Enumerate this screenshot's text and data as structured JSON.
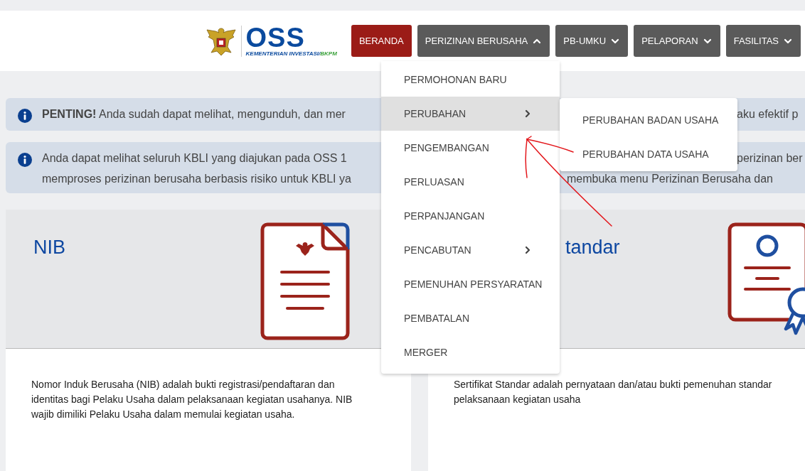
{
  "header": {
    "logo": {
      "name": "OSS",
      "subtitle": "KEMENTERIAN INVESTASI/",
      "subtitle_accent": "BKPM"
    },
    "nav": [
      {
        "label": "BERANDA",
        "kind": "link",
        "selected": true
      },
      {
        "label": "PERIZINAN BERUSAHA",
        "kind": "dropdown",
        "selected": false,
        "expanded": true
      },
      {
        "label": "PB-UMKU",
        "kind": "dropdown",
        "selected": false,
        "expanded": false
      },
      {
        "label": "PELAPORAN",
        "kind": "dropdown",
        "selected": false,
        "expanded": false
      },
      {
        "label": "FASILITAS",
        "kind": "dropdown",
        "selected": false,
        "expanded": false
      }
    ]
  },
  "alerts": [
    {
      "lines": [
        {
          "left": "**PENTING!** Anda sudah dapat melihat, mengunduh, dan mer",
          "right": "aku efektif p"
        }
      ]
    },
    {
      "lines": [
        {
          "left": "Anda dapat melihat seluruh KBLI yang diajukan pada OSS 1",
          "right": "perizinan ber"
        },
        {
          "left": "memproses perizinan berusaha berbasis risiko untuk KBLI ya",
          "right": "membuka menu Perizinan Berusaha dan"
        }
      ]
    }
  ],
  "cards": [
    {
      "title": "NIB",
      "kind": "document",
      "description": "Nomor Induk Berusaha (NIB) adalah bukti registrasi/pendaftaran dan identitas bagi Pelaku Usaha dalam pelaksanaan kegiatan usahanya. NIB wajib dimiliki Pelaku Usaha dalam memulai kegiatan usaha."
    },
    {
      "title": "tandar",
      "kind": "certificate",
      "description": "Sertifikat Standar adalah pernyataan dan/atau bukti pemenuhan standar pelaksanaan kegiatan usaha"
    }
  ],
  "dropdown_menu": {
    "items": [
      {
        "label": "PERMOHONAN BARU",
        "has_submenu": false,
        "selected": false
      },
      {
        "label": "PERUBAHAN",
        "has_submenu": true,
        "selected": true
      },
      {
        "label": "PENGEMBANGAN",
        "has_submenu": false,
        "selected": false
      },
      {
        "label": "PERLUASAN",
        "has_submenu": false,
        "selected": false
      },
      {
        "label": "PERPANJANGAN",
        "has_submenu": false,
        "selected": false
      },
      {
        "label": "PENCABUTAN",
        "has_submenu": true,
        "selected": false
      },
      {
        "label": "PEMENUHAN PERSYARATAN",
        "has_submenu": false,
        "selected": false
      },
      {
        "label": "PEMBATALAN",
        "has_submenu": false,
        "selected": false
      },
      {
        "label": "MERGER",
        "has_submenu": false,
        "selected": false
      }
    ]
  },
  "submenu": {
    "items": [
      {
        "label": "PERUBAHAN BADAN USAHA"
      },
      {
        "label": "PERUBAHAN DATA USAHA"
      }
    ]
  }
}
